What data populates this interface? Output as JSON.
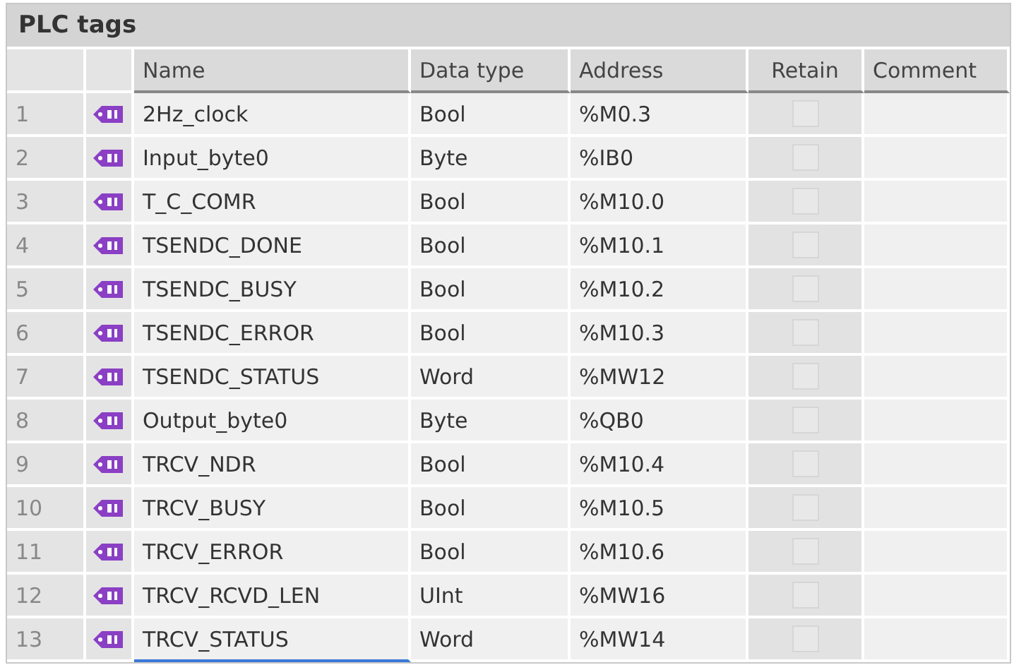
{
  "panel": {
    "title": "PLC tags"
  },
  "table": {
    "columns": [
      "Name",
      "Data type",
      "Address",
      "Retain",
      "Comment"
    ],
    "rows": [
      {
        "index": "1",
        "name": "2Hz_clock",
        "data_type": "Bool",
        "address": "%M0.3",
        "retain": false,
        "selected": false
      },
      {
        "index": "2",
        "name": "Input_byte0",
        "data_type": "Byte",
        "address": "%IB0",
        "retain": false,
        "selected": false
      },
      {
        "index": "3",
        "name": "T_C_COMR",
        "data_type": "Bool",
        "address": "%M10.0",
        "retain": false,
        "selected": false
      },
      {
        "index": "4",
        "name": "TSENDC_DONE",
        "data_type": "Bool",
        "address": "%M10.1",
        "retain": false,
        "selected": false
      },
      {
        "index": "5",
        "name": "TSENDC_BUSY",
        "data_type": "Bool",
        "address": "%M10.2",
        "retain": false,
        "selected": false
      },
      {
        "index": "6",
        "name": "TSENDC_ERROR",
        "data_type": "Bool",
        "address": "%M10.3",
        "retain": false,
        "selected": false
      },
      {
        "index": "7",
        "name": "TSENDC_STATUS",
        "data_type": "Word",
        "address": "%MW12",
        "retain": false,
        "selected": false
      },
      {
        "index": "8",
        "name": "Output_byte0",
        "data_type": "Byte",
        "address": "%QB0",
        "retain": false,
        "selected": false
      },
      {
        "index": "9",
        "name": "TRCV_NDR",
        "data_type": "Bool",
        "address": "%M10.4",
        "retain": false,
        "selected": false
      },
      {
        "index": "10",
        "name": "TRCV_BUSY",
        "data_type": "Bool",
        "address": "%M10.5",
        "retain": false,
        "selected": false
      },
      {
        "index": "11",
        "name": "TRCV_ERROR",
        "data_type": "Bool",
        "address": "%M10.6",
        "retain": false,
        "selected": false
      },
      {
        "index": "12",
        "name": "TRCV_RCVD_LEN",
        "data_type": "UInt",
        "address": "%MW16",
        "retain": false,
        "selected": false
      },
      {
        "index": "13",
        "name": "TRCV_STATUS",
        "data_type": "Word",
        "address": "%MW14",
        "retain": false,
        "selected": true
      }
    ]
  }
}
